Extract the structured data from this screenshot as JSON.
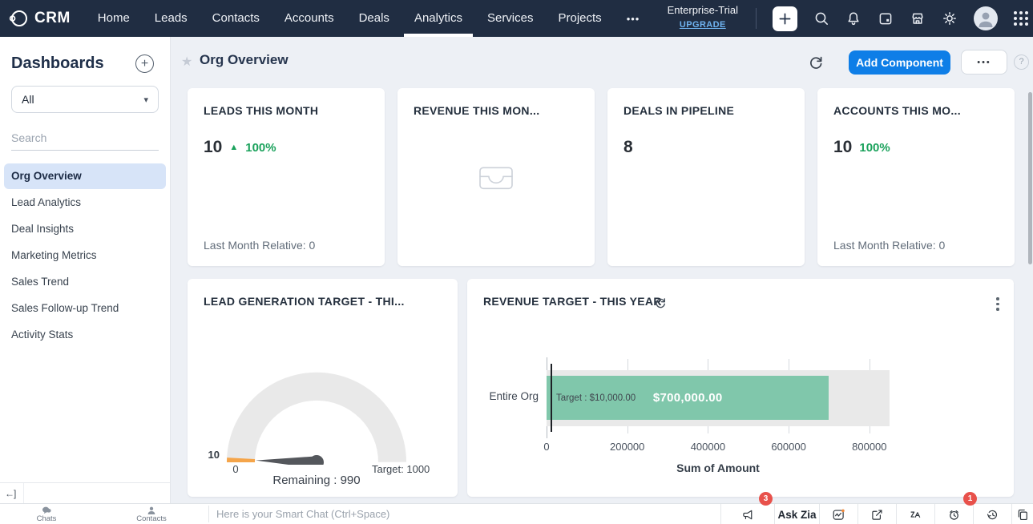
{
  "colors": {
    "navbar_bg": "#202d42",
    "accent_blue": "#0e7ee7",
    "positive_green": "#1ba25c",
    "badge_red": "#e8514b",
    "bar_green": "#80c7ab",
    "gauge_orange": "#f5a54a",
    "sidebar_active_bg": "#d7e4f8",
    "main_bg": "#edf0f5"
  },
  "glyphs": {
    "plus": "+",
    "caret_down": "▾",
    "star": "★",
    "help": "?",
    "more_h": "•••",
    "delta_up": "▲",
    "collapse": "←]"
  },
  "navbar": {
    "brand": "CRM",
    "items": [
      "Home",
      "Leads",
      "Contacts",
      "Accounts",
      "Deals",
      "Analytics",
      "Services",
      "Projects"
    ],
    "active_item": "Analytics",
    "more_label": "•••",
    "plan_label": "Enterprise-Trial",
    "upgrade_label": "UPGRADE"
  },
  "sidebar": {
    "title": "Dashboards",
    "filter_value": "All",
    "search_placeholder": "Search",
    "items": [
      "Org Overview",
      "Lead Analytics",
      "Deal Insights",
      "Marketing Metrics",
      "Sales Trend",
      "Sales Follow-up Trend",
      "Activity Stats"
    ],
    "active_item": "Org Overview"
  },
  "header": {
    "title": "Org Overview",
    "add_component_label": "Add Component"
  },
  "kpi_cards": [
    {
      "title": "LEADS THIS MONTH",
      "value": "10",
      "delta": "100%",
      "footer": "Last Month Relative: 0"
    },
    {
      "title": "REVENUE THIS MON..."
    },
    {
      "title": "DEALS IN PIPELINE",
      "value": "8"
    },
    {
      "title": "ACCOUNTS THIS MO...",
      "value": "10",
      "delta": "100%",
      "footer": "Last Month Relative: 0"
    }
  ],
  "chart_data": [
    {
      "type": "gauge",
      "title": "LEAD GENERATION TARGET - THI...",
      "value": 10,
      "min": 0,
      "target": 1000,
      "remaining": 990,
      "value_label": "10",
      "min_label": "0",
      "target_label": "Target: 1000",
      "remaining_label": "Remaining : 990",
      "colors": {
        "track": "#e9e9e9",
        "value": "#f5a54a",
        "needle": "#54575c"
      }
    },
    {
      "type": "bar",
      "orientation": "horizontal",
      "title": "REVENUE TARGET - THIS YEAR",
      "categories": [
        "Entire Org"
      ],
      "values": [
        700000
      ],
      "value_labels": [
        "$700,000.00"
      ],
      "target_value": 10000,
      "target_label": "Target : $10,000.00",
      "xlabel": "Sum of Amount",
      "xlim": [
        0,
        850000
      ],
      "xticks": [
        {
          "value": 0,
          "label": "0"
        },
        {
          "value": 200000,
          "label": "200000"
        },
        {
          "value": 400000,
          "label": "400000"
        },
        {
          "value": 600000,
          "label": "600000"
        },
        {
          "value": 800000,
          "label": "800000"
        }
      ],
      "bar_color": "#80c7ab",
      "track_color": "#e9e9e9",
      "grid": true,
      "legend": false
    }
  ],
  "bottom_bar": {
    "chats_label": "Chats",
    "contacts_label": "Contacts",
    "smart_chat_placeholder": "Here is your Smart Chat (Ctrl+Space)",
    "ask_zia_label": "Ask Zia",
    "announcement_badge": "3",
    "reminder_badge": "1"
  }
}
